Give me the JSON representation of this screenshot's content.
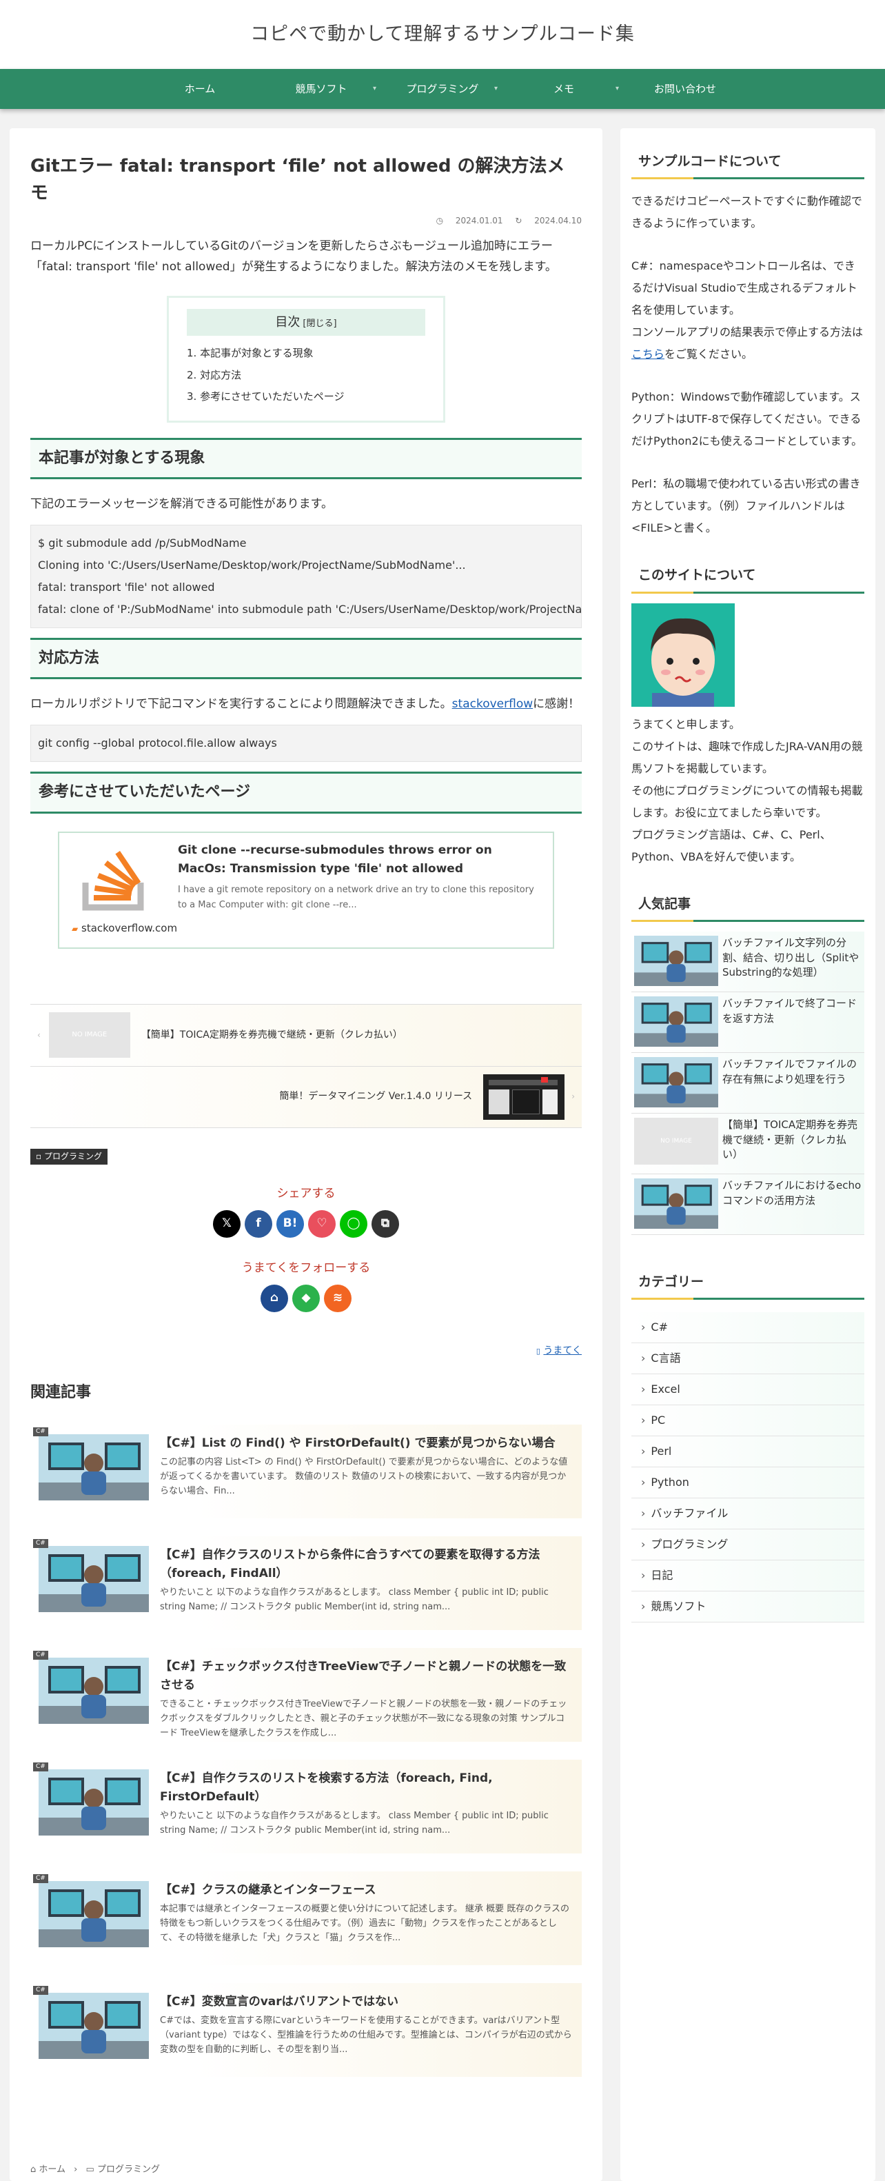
{
  "site": {
    "title": "コピペで動かして理解するサンプルコード集"
  },
  "nav": [
    {
      "label": "ホーム",
      "has_children": false
    },
    {
      "label": "競馬ソフト",
      "has_children": true
    },
    {
      "label": "プログラミング",
      "has_children": true
    },
    {
      "label": "メモ",
      "has_children": true
    },
    {
      "label": "お問い合わせ",
      "has_children": false
    }
  ],
  "article": {
    "title": "Gitエラー fatal: transport ‘file’ not allowed の解決方法メモ",
    "published": "2024.01.01",
    "updated": "2024.04.10",
    "intro": "ローカルPCにインストールしているGitのバージョンを更新したらさぶもージュール追加時にエラー「fatal: transport 'file' not allowed」が発生するようになりました。解決方法のメモを残します。",
    "toc": {
      "title": "目次",
      "toggle": "[閉じる]",
      "items": [
        "1. 本記事が対象とする現象",
        "2. 対応方法",
        "3. 参考にさせていただいたページ"
      ]
    },
    "sections": {
      "s1": {
        "heading": "本記事が対象とする現象",
        "text": "下記のエラーメッセージを解消できる可能性があります。",
        "code": "$ git submodule add /p/SubModName\nCloning into 'C:/Users/UserName/Desktop/work/ProjectName/SubModName'...\nfatal: transport 'file' not allowed\nfatal: clone of 'P:/SubModName' into submodule path 'C:/Users/UserName/Desktop/work/ProjectName/SubModName' failed"
      },
      "s2": {
        "heading": "対応方法",
        "text_before": "ローカルリポジトリで下記コマンドを実行することにより問題解決できました。",
        "link": "stackoverflow",
        "text_after": "に感謝！",
        "code": "git config --global protocol.file.allow always"
      },
      "s3": {
        "heading": "参考にさせていただいたページ",
        "card": {
          "title": "Git clone --recurse-submodules throws error on MacOs: Transmission type 'file' not allowed",
          "desc": "I have a git remote repository on a network drive an try to clone this repository to a Mac Computer with: git clone --re...",
          "site": "stackoverflow.com"
        }
      }
    },
    "prev": {
      "title": "【簡単】TOICA定期券を券売機で継続・更新（クレカ払い）",
      "noimage": "NO IMAGE"
    },
    "next": {
      "title": "簡単！データマイニング Ver.1.4.0 リリース"
    },
    "category_label": "プログラミング",
    "share_title": "シェアする",
    "follow_title": "うまてくをフォローする",
    "author": "うまてく"
  },
  "share_icons": [
    {
      "name": "x-icon",
      "glyph": "𝕏",
      "color": "#000000"
    },
    {
      "name": "facebook-icon",
      "glyph": "f",
      "color": "#2d5a9a"
    },
    {
      "name": "hatena-icon",
      "glyph": "B!",
      "color": "#2c6ebd"
    },
    {
      "name": "pocket-icon",
      "glyph": "♡",
      "color": "#e94f5d"
    },
    {
      "name": "line-icon",
      "glyph": "◯",
      "color": "#00c300"
    },
    {
      "name": "copy-icon",
      "glyph": "⧉",
      "color": "#333333"
    }
  ],
  "follow_icons": [
    {
      "name": "home-icon",
      "glyph": "⌂",
      "color": "#1f4b8f"
    },
    {
      "name": "feedly-icon",
      "glyph": "◆",
      "color": "#2bb24c"
    },
    {
      "name": "rss-icon",
      "glyph": "≋",
      "color": "#f26522"
    }
  ],
  "related": {
    "heading": "関連記事",
    "badge": "C#",
    "items": [
      {
        "title": "【C#】List の Find() や FirstOrDefault() で要素が見つからない場合",
        "desc": "この記事の内容 List<T> の Find() や FirstOrDefault() で要素が見つからない場合に、どのような値が返ってくるかを書いています。 数値のリスト 数値のリストの検索において、一致する内容が見つからない場合、Fin..."
      },
      {
        "title": "【C#】自作クラスのリストから条件に合うすべての要素を取得する方法（foreach, FindAll）",
        "desc": "やりたいこと 以下のような自作クラスがあるとします。 class Member { public int ID; public string Name; // コンストラクタ public Member(int id, string nam..."
      },
      {
        "title": "【C#】チェックボックス付きTreeViewで子ノードと親ノードの状態を一致させる",
        "desc": "できること・チェックボックス付きTreeViewで子ノードと親ノードの状態を一致・親ノードのチェックボックスをダブルクリックしたとき、親と子のチェック状態が不一致になる現象の対策 サンプルコード TreeViewを継承したクラスを作成し..."
      },
      {
        "title": "【C#】自作クラスのリストを検索する方法（foreach, Find, FirstOrDefault）",
        "desc": "やりたいこと 以下のような自作クラスがあるとします。 class Member { public int ID; public string Name; // コンストラクタ public Member(int id, string nam..."
      },
      {
        "title": "【C#】クラスの継承とインターフェース",
        "desc": "本記事では継承とインターフェースの概要と使い分けについて記述します。 継承 概要 既存のクラスの特徴をもつ新しいクラスをつくる仕組みです。（例）過去に「動物」クラスを作ったことがあるとして、その特徴を継承した「犬」クラスと「猫」クラスを作..."
      },
      {
        "title": "【C#】変数宣言のvarはバリアントではない",
        "desc": "C#では、変数を宣言する際にvarというキーワードを使用することができます。varはバリアント型（variant type）ではなく、型推論を行うための仕組みです。型推論とは、コンパイラが右辺の式から変数の型を自動的に判断し、その型を割り当..."
      }
    ]
  },
  "breadcrumb": [
    "ホーム",
    "プログラミング"
  ],
  "sidebar": {
    "about_code": {
      "heading": "サンプルコードについて",
      "p1": "できるだけコピーペーストですぐに動作確認できるように作っています。",
      "p2a": "C#：namespaceやコントロール名は、できるだけVisual Studioで生成されるデフォルト名を使用しています。",
      "p2b": "コンソールアプリの結果表示で停止する方法は",
      "p2link": "こちら",
      "p2c": "をご覧ください。",
      "p3": "Python：Windowsで動作確認しています。スクリプトはUTF-8で保存してください。できるだけPython2にも使えるコードとしています。",
      "p4": "Perl：私の職場で使われている古い形式の書き方としています。（例）ファイルハンドルは<FILE>と書く。"
    },
    "about_site": {
      "heading": "このサイトについて",
      "text": "うまてくと申します。\nこのサイトは、趣味で作成したJRA-VAN用の競馬ソフトを掲載しています。\nその他にプログラミングについての情報も掲載します。お役に立てましたら幸いです。\nプログラミング言語は、C#、C、Perl、Python、VBAを好んで使います。"
    },
    "popular": {
      "heading": "人気記事",
      "noimage": "NO IMAGE",
      "items": [
        "バッチファイル文字列の分割、結合、切り出し（SplitやSubstring的な処理）",
        "バッチファイルで終了コードを返す方法",
        "バッチファイルでファイルの存在有無により処理を行う",
        "【簡単】TOICA定期券を券売機で継続・更新（クレカ払い）",
        "バッチファイルにおけるechoコマンドの活用方法"
      ]
    },
    "categories": {
      "heading": "カテゴリー",
      "items": [
        "C#",
        "C言語",
        "Excel",
        "PC",
        "Perl",
        "Python",
        "バッチファイル",
        "プログラミング",
        "日記",
        "競馬ソフト"
      ]
    }
  },
  "colors": {
    "accent": "#2e8b66",
    "link": "#1a5fb4",
    "share": "#c0392b",
    "highlight": "#f2c94c"
  }
}
